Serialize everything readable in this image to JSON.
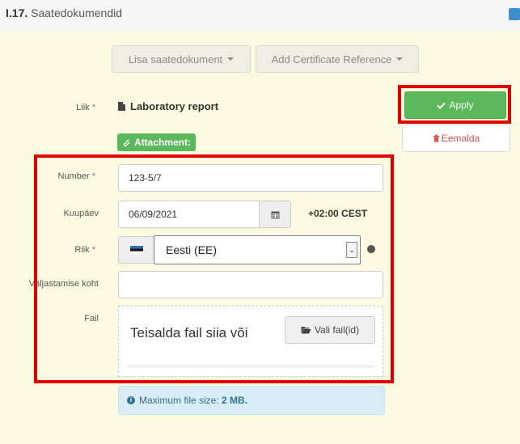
{
  "section": {
    "number": "I.17.",
    "title": "Saatedokumendid"
  },
  "toolbar": {
    "add_document": "Lisa saatedokument",
    "add_reference": "Add Certificate Reference"
  },
  "actions": {
    "apply": "Apply",
    "remove": "Eemalda"
  },
  "document": {
    "type_label": "Liik",
    "type_value": "Laboratory report",
    "attachment_badge": "Attachment:"
  },
  "form": {
    "number_label": "Number",
    "number_value": "123-5/7",
    "date_label": "Kuupäev",
    "date_value": "06/09/2021",
    "timezone": "+02:00 CEST",
    "country_label": "Riik",
    "country_value": "Eesti (EE)",
    "place_label": "Väljastamise koht",
    "place_value": "",
    "file_label": "Fail",
    "drop_text": "Teisalda fail siia või",
    "choose_files": "Vali fail(id)"
  },
  "info": {
    "prefix": "Maximum file size:",
    "value": "2 MB."
  },
  "colors": {
    "panel_bg": "#fcfae0",
    "success": "#5cb85c",
    "danger": "#d9534f",
    "highlight": "#e00000",
    "info_bg": "#d9edf7"
  }
}
